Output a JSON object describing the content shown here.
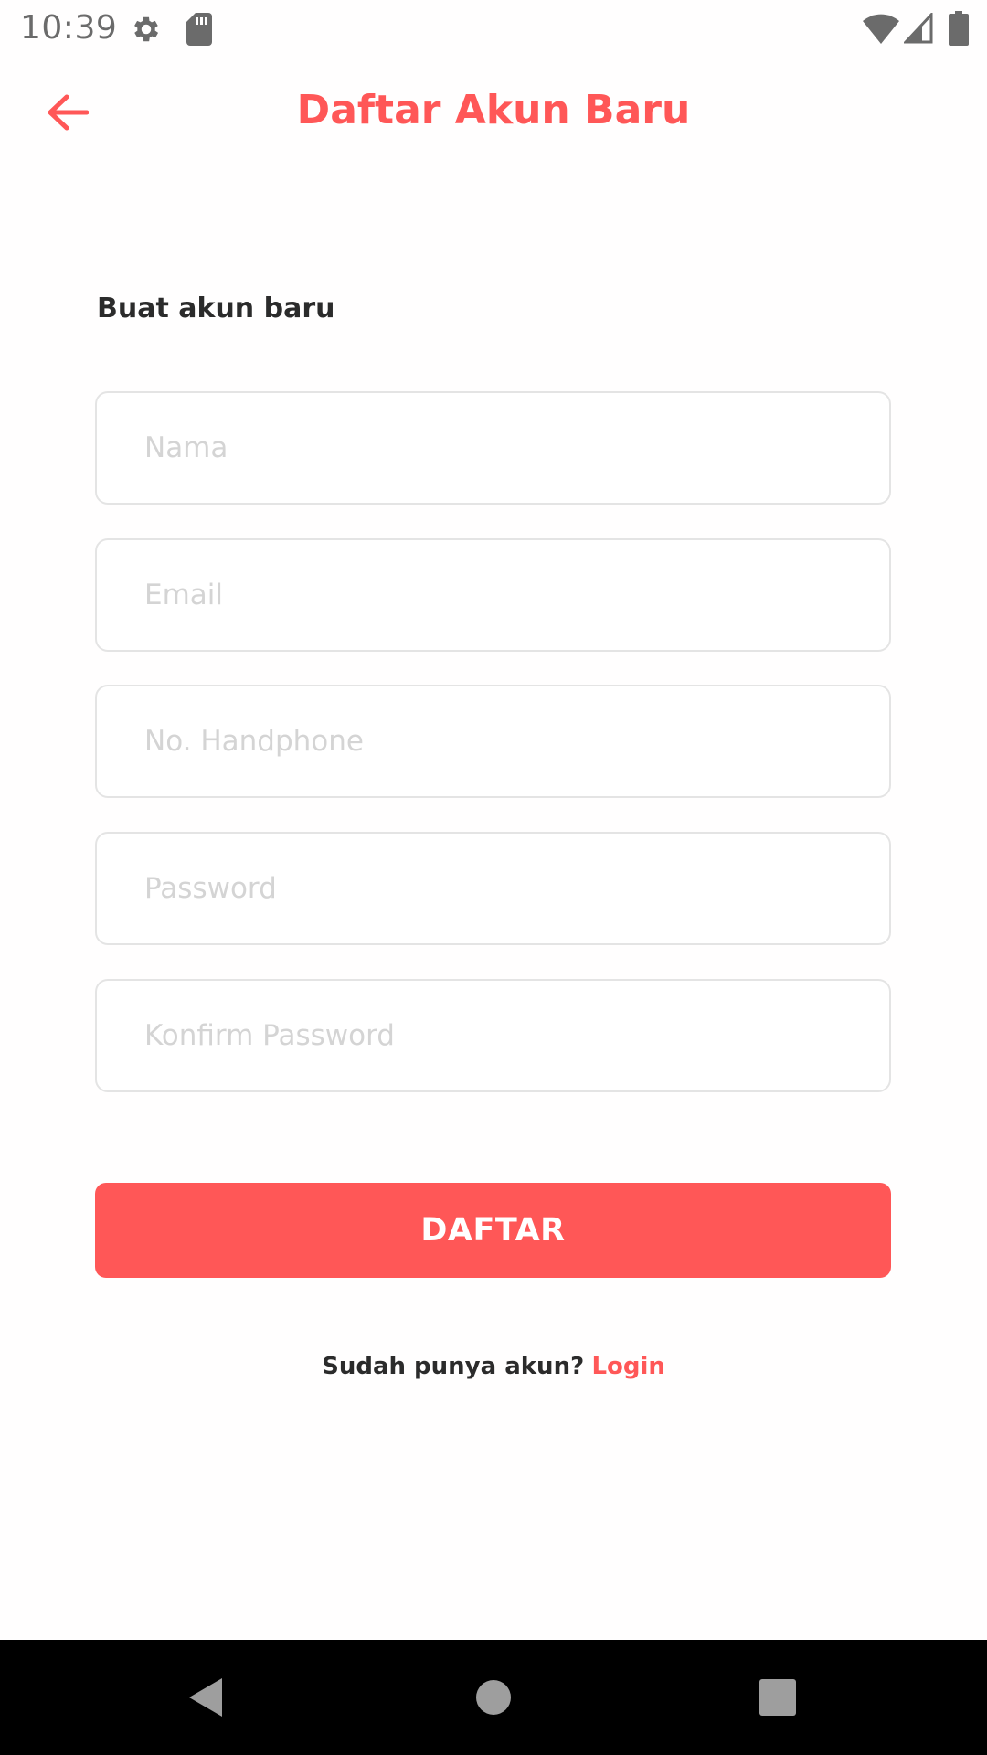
{
  "status_bar": {
    "time": "10:39",
    "icons": [
      "gear-icon",
      "sd-card-icon",
      "wifi-icon",
      "signal-icon",
      "battery-icon"
    ]
  },
  "app_bar": {
    "title": "Daftar Akun Baru",
    "back_icon": "arrow-left-icon"
  },
  "form": {
    "heading": "Buat akun baru",
    "fields": [
      {
        "placeholder": "Nama",
        "value": ""
      },
      {
        "placeholder": "Email",
        "value": ""
      },
      {
        "placeholder": "No. Handphone",
        "value": ""
      },
      {
        "placeholder": "Password",
        "value": ""
      },
      {
        "placeholder": "Konfirm Password",
        "value": ""
      }
    ],
    "submit_label": "DAFTAR"
  },
  "footer": {
    "prompt": "Sudah punya akun?",
    "login_link": "Login"
  },
  "nav_bar": {
    "icons": [
      "back-triangle-icon",
      "home-circle-icon",
      "recents-square-icon"
    ]
  },
  "colors": {
    "accent": "#ff5757",
    "text": "#2b2b2b",
    "field_border": "#e4e4e4",
    "placeholder": "#d4d4d4"
  }
}
